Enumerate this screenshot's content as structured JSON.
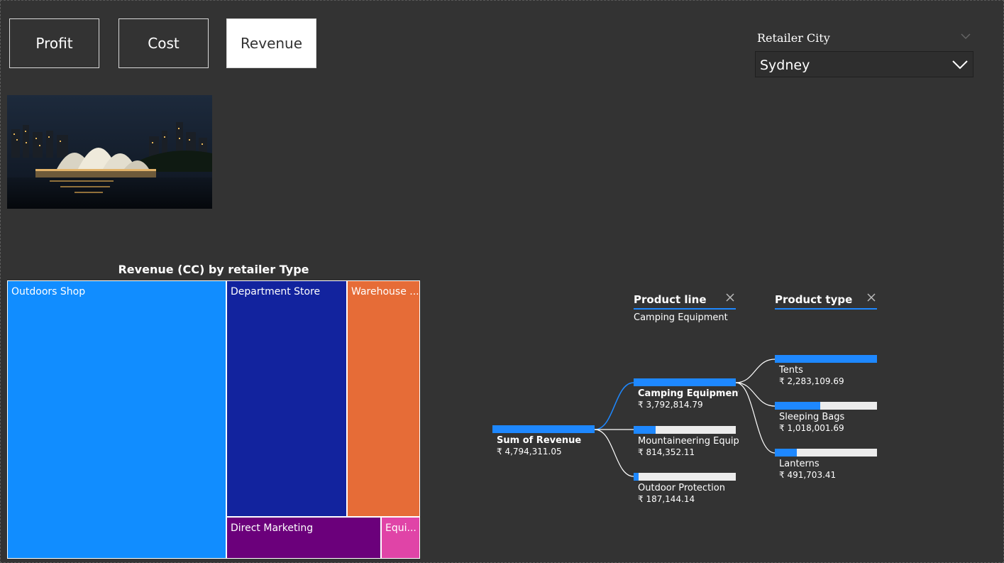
{
  "nav": {
    "profit_label": "Profit",
    "cost_label": "Cost",
    "revenue_label": "Revenue",
    "active": "Revenue"
  },
  "slicer": {
    "title": "Retailer City",
    "selected": "Sydney"
  },
  "image": {
    "subject": "sydney-opera-house-night-photo"
  },
  "treemap": {
    "title": "Revenue (CC) by retailer Type",
    "items": [
      {
        "label": "Outdoors Shop",
        "color": "#118dff"
      },
      {
        "label": "Department Store",
        "color": "#12239e"
      },
      {
        "label": "Warehouse ...",
        "color": "#e66c37"
      },
      {
        "label": "Direct Marketing",
        "color": "#6b007b"
      },
      {
        "label": "Equi...",
        "color": "#e044a7"
      }
    ]
  },
  "decomp": {
    "header1": "Product line",
    "header1_filter": "Camping Equipment",
    "header2": "Product type",
    "root": {
      "label": "Sum of Revenue",
      "value": "₹ 4,794,311.05",
      "fill": 1.0
    },
    "level1": [
      {
        "label": "Camping Equipment",
        "value": "₹ 3,792,814.79",
        "fill": 1.0,
        "selected": true
      },
      {
        "label": "Mountaineering Equip...",
        "value": "₹ 814,352.11",
        "fill": 0.215,
        "selected": false
      },
      {
        "label": "Outdoor Protection",
        "value": "₹ 187,144.14",
        "fill": 0.05,
        "selected": false
      }
    ],
    "level2": [
      {
        "label": "Tents",
        "value": "₹ 2,283,109.69",
        "fill": 1.0
      },
      {
        "label": "Sleeping Bags",
        "value": "₹ 1,018,001.69",
        "fill": 0.446
      },
      {
        "label": "Lanterns",
        "value": "₹ 491,703.41",
        "fill": 0.215
      }
    ],
    "colors": {
      "accent": "#1e88ff",
      "track": "#ececec",
      "link": "#ffffff"
    }
  }
}
